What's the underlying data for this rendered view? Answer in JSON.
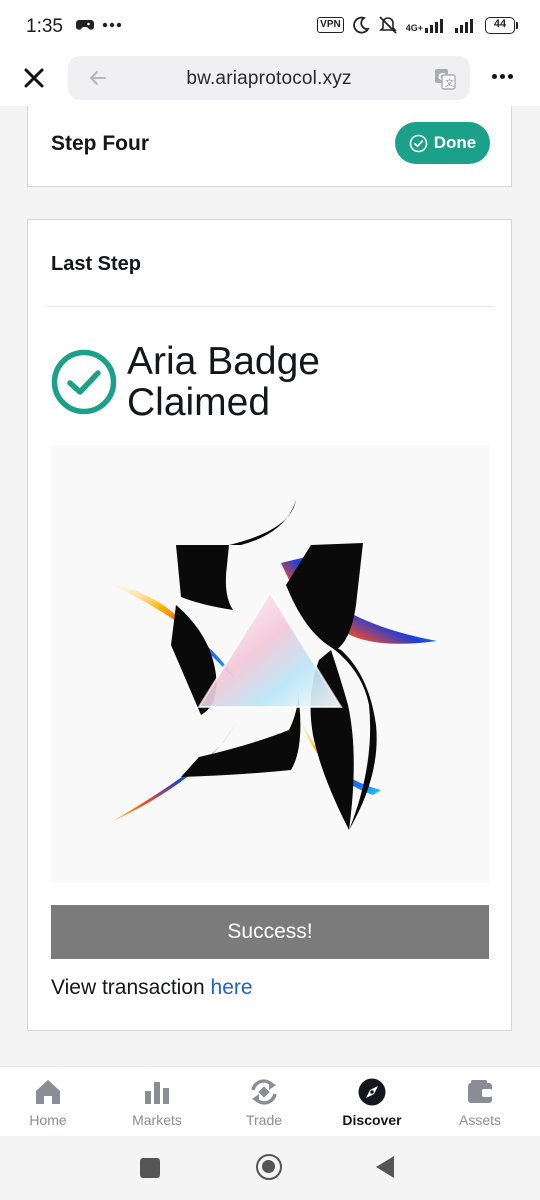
{
  "status_bar": {
    "time": "1:35",
    "battery": "44",
    "vpn": "VPN",
    "network": "4G+"
  },
  "browser": {
    "url": "bw.ariaprotocol.xyz",
    "icons": [
      "close-icon",
      "back-arrow-icon",
      "translate-icon",
      "more-icon"
    ]
  },
  "step_four": {
    "title": "Step Four",
    "status": "Done"
  },
  "last_step": {
    "title": "Last Step",
    "claim_title": "Aria Badge Claimed",
    "success_button": "Success!",
    "tx_prefix": "View transaction ",
    "tx_link": "here"
  },
  "bottom_nav": {
    "items": [
      {
        "label": "Home",
        "icon": "home-icon"
      },
      {
        "label": "Markets",
        "icon": "bar-chart-icon"
      },
      {
        "label": "Trade",
        "icon": "trade-icon"
      },
      {
        "label": "Discover",
        "icon": "compass-icon",
        "active": true
      },
      {
        "label": "Assets",
        "icon": "wallet-icon"
      }
    ]
  },
  "colors": {
    "accent_green": "#1ba089",
    "link_blue": "#1f5fd6",
    "button_gray": "#7b7b7b"
  }
}
